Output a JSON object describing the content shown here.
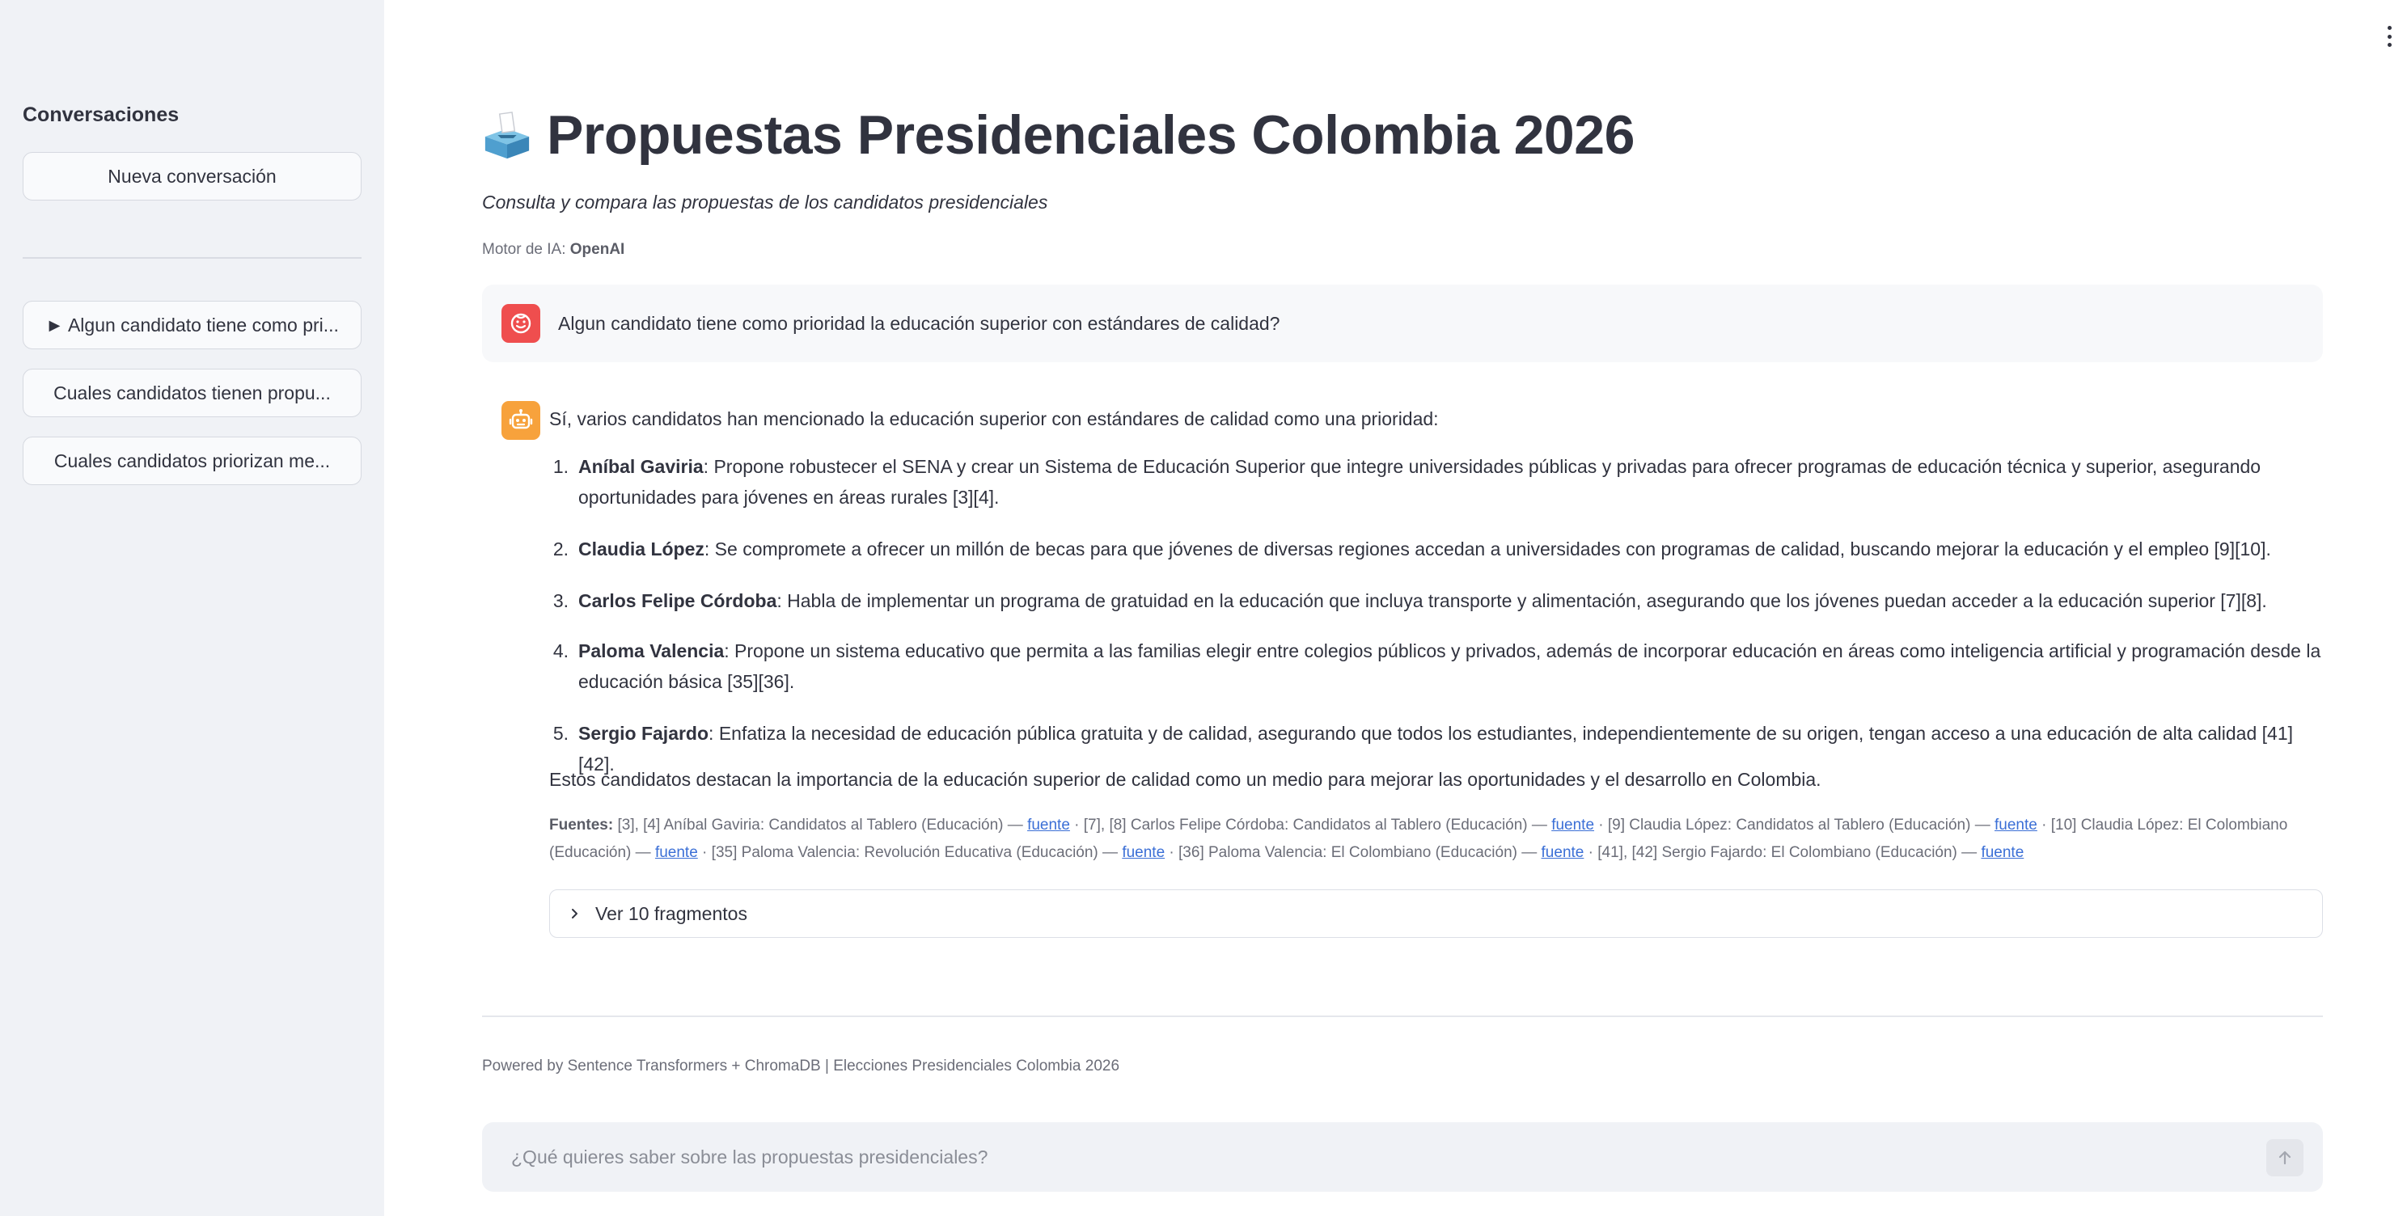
{
  "sidebar": {
    "title": "Conversaciones",
    "new_button": "Nueva conversación",
    "history": [
      {
        "label": "► Algun candidato tiene como pri..."
      },
      {
        "label": "Cuales candidatos tienen propu..."
      },
      {
        "label": "Cuales candidatos priorizan me..."
      }
    ]
  },
  "header": {
    "title": "Propuestas Presidenciales Colombia 2026",
    "subtitle": "Consulta y compara las propuestas de los candidatos presidenciales",
    "engine_label": "Motor de IA:",
    "engine_value": "OpenAI"
  },
  "conversation": {
    "user_message": "Algun candidato tiene como prioridad la educación superior con estándares de calidad?",
    "bot_intro": "Sí, varios candidatos han mencionado la educación superior con estándares de calidad como una prioridad:",
    "points": [
      {
        "num": "1.",
        "name": "Aníbal Gaviria",
        "text": ": Propone robustecer el SENA y crear un Sistema de Educación Superior que integre universidades públicas y privadas para ofrecer programas de educación técnica y superior, asegurando oportunidades para jóvenes en áreas rurales [3][4]."
      },
      {
        "num": "2.",
        "name": "Claudia López",
        "text": ": Se compromete a ofrecer un millón de becas para que jóvenes de diversas regiones accedan a universidades con programas de calidad, buscando mejorar la educación y el empleo [9][10]."
      },
      {
        "num": "3.",
        "name": "Carlos Felipe Córdoba",
        "text": ": Habla de implementar un programa de gratuidad en la educación que incluya transporte y alimentación, asegurando que los jóvenes puedan acceder a la educación superior [7][8]."
      },
      {
        "num": "4.",
        "name": "Paloma Valencia",
        "text": ": Propone un sistema educativo que permita a las familias elegir entre colegios públicos y privados, además de incorporar educación en áreas como inteligencia artificial y programación desde la educación básica [35][36]."
      },
      {
        "num": "5.",
        "name": "Sergio Fajardo",
        "text": ": Enfatiza la necesidad de educación pública gratuita y de calidad, asegurando que todos los estudiantes, independientemente de su origen, tengan acceso a una educación de alta calidad [41][42]."
      }
    ],
    "closing": "Estos candidatos destacan la importancia de la educación superior de calidad como un medio para mejorar las oportunidades y el desarrollo en Colombia.",
    "sources_label": "Fuentes:",
    "sources": [
      {
        "text": "[3], [4] Aníbal Gaviria: Candidatos al Tablero (Educación) — ",
        "link": "fuente",
        "sep": " · "
      },
      {
        "text": "[7], [8] Carlos Felipe Córdoba: Candidatos al Tablero (Educación) — ",
        "link": "fuente",
        "sep": " · "
      },
      {
        "text": "[9] Claudia López: Candidatos al Tablero (Educación) — ",
        "link": "fuente",
        "sep": " · "
      },
      {
        "text": "[10] Claudia López: El Colombiano (Educación) — ",
        "link": "fuente",
        "sep": " · "
      },
      {
        "text": "[35] Paloma Valencia: Revolución Educativa (Educación) — ",
        "link": "fuente",
        "sep": " · "
      },
      {
        "text": "[36] Paloma Valencia: El Colombiano (Educación) — ",
        "link": "fuente",
        "sep": " · "
      },
      {
        "text": "[41], [42] Sergio Fajardo: El Colombiano (Educación) — ",
        "link": "fuente",
        "sep": ""
      }
    ],
    "expander_label": "Ver 10 fragmentos"
  },
  "footer": {
    "text": "Powered by Sentence Transformers + ChromaDB | Elecciones Presidenciales Colombia 2026"
  },
  "chat_input": {
    "placeholder": "¿Qué quieres saber sobre las propuestas presidenciales?"
  },
  "colors": {
    "sidebar_bg": "#f0f2f6",
    "user_avatar": "#ef4e4e",
    "bot_avatar": "#f7a23c",
    "link": "#3b6fd6"
  }
}
